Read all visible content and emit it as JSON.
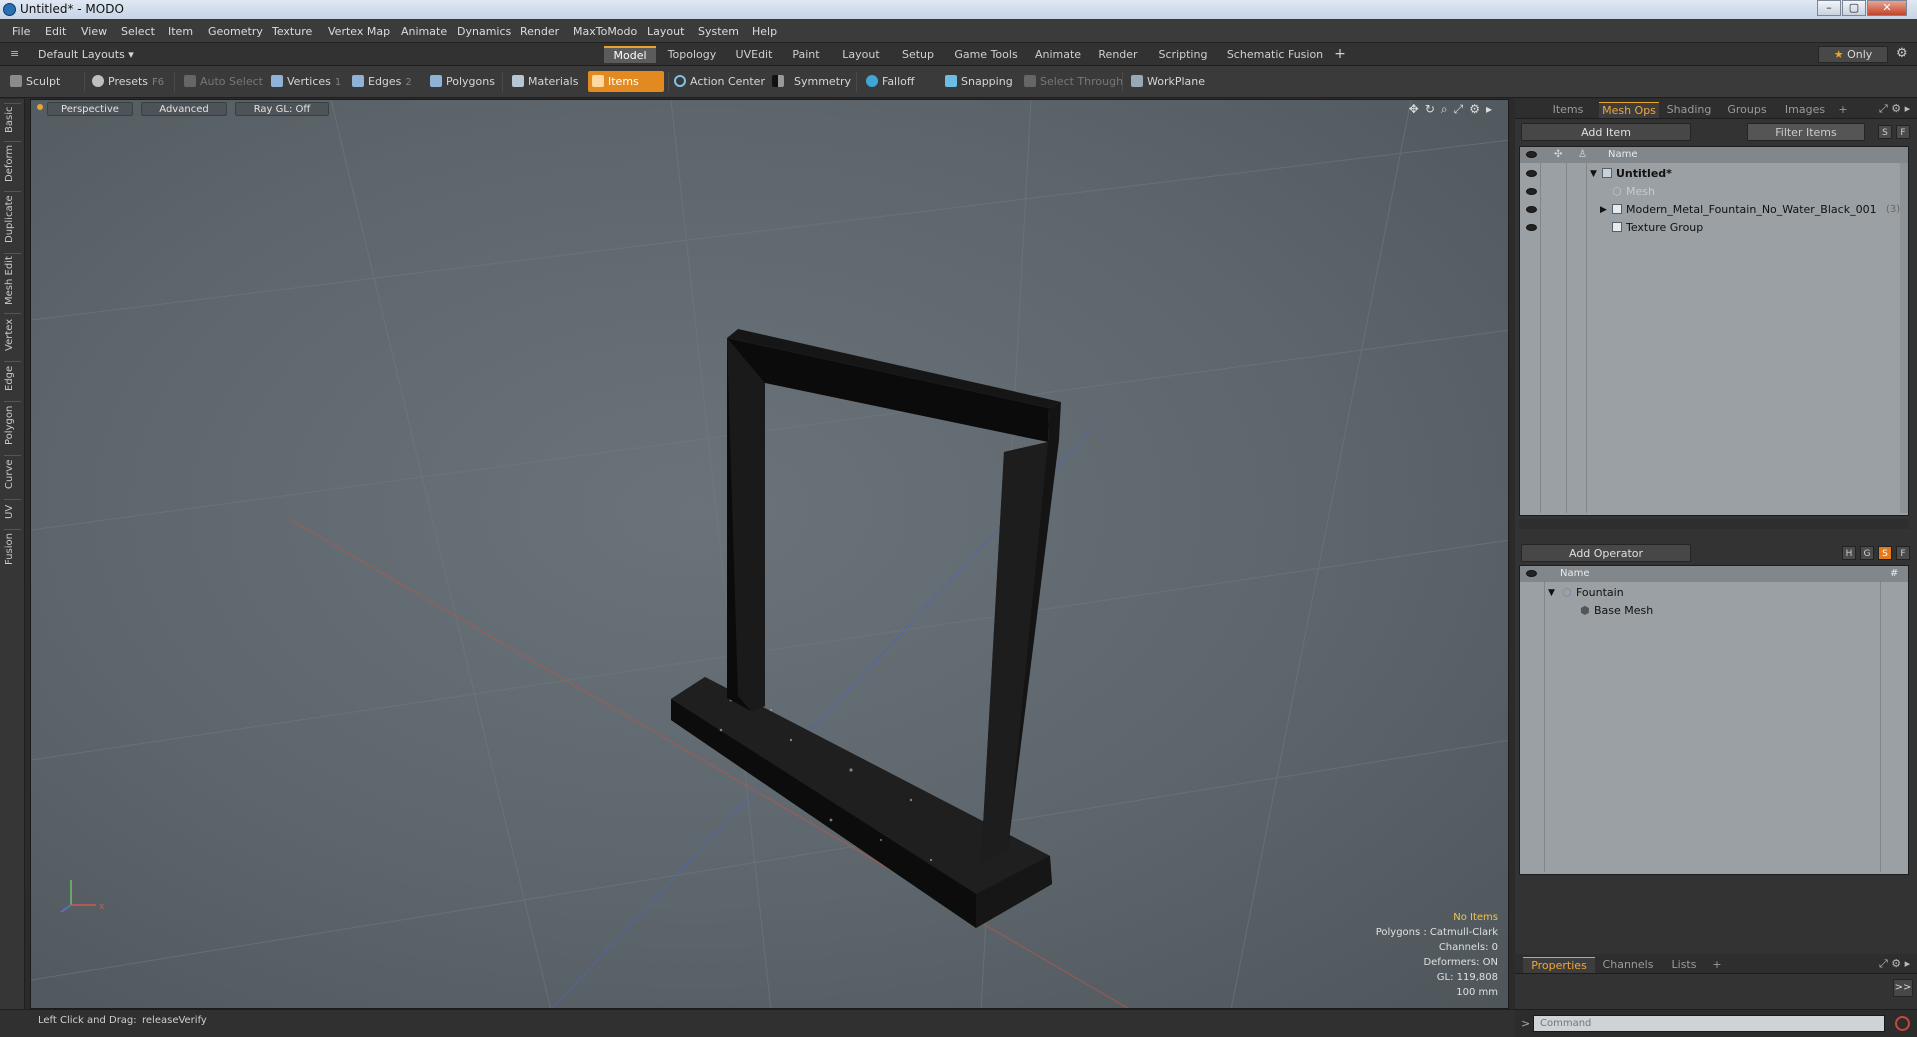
{
  "window": {
    "title": "Untitled* - MODO",
    "controls": [
      "–",
      "▢",
      "✕"
    ]
  },
  "menu": [
    "File",
    "Edit",
    "View",
    "Select",
    "Item",
    "Geometry",
    "Texture",
    "Vertex Map",
    "Animate",
    "Dynamics",
    "Render",
    "MaxToModo",
    "Layout",
    "System",
    "Help"
  ],
  "layout_bar": {
    "layout_name": "Default Layouts ▾",
    "tabs": [
      "Model",
      "Topology",
      "UVEdit",
      "Paint",
      "Layout",
      "Setup",
      "Game Tools",
      "Animate",
      "Render",
      "Scripting",
      "Schematic Fusion"
    ],
    "active_tab": "Model",
    "add_tab": "+",
    "only_label": "Only"
  },
  "toolbar": {
    "sculpt": "Sculpt",
    "presets": "Presets",
    "presets_key": "F6",
    "auto_select": "Auto Select",
    "vertices": "Vertices",
    "vertices_key": "1",
    "edges": "Edges",
    "edges_key": "2",
    "polygons": "Polygons",
    "materials": "Materials",
    "items": "Items",
    "action_center": "Action Center",
    "symmetry": "Symmetry",
    "falloff": "Falloff",
    "snapping": "Snapping",
    "select_through": "Select Through",
    "workplane": "WorkPlane"
  },
  "left_tabs": [
    "Basic",
    "Deform",
    "Duplicate",
    "Mesh Edit",
    "Vertex",
    "Edge",
    "Polygon",
    "Curve",
    "UV",
    "Fusion"
  ],
  "viewport": {
    "view_mode": "Perspective",
    "shading": "Advanced",
    "raygl": "Ray GL: Off",
    "stats": {
      "selection": "No Items",
      "polygons": "Polygons : Catmull-Clark",
      "channels": "Channels: 0",
      "deformers": "Deformers: ON",
      "gl": "GL: 119,808",
      "grid": "100 mm"
    }
  },
  "status_bar": {
    "hint": "Left Click and Drag:",
    "action": "releaseVerify"
  },
  "item_panel": {
    "tabs": [
      "Items",
      "Mesh Ops",
      "Shading",
      "Groups",
      "Images",
      "+"
    ],
    "active_tab": "Mesh Ops",
    "add_item": "Add Item",
    "filter": "Filter Items",
    "btn_s": "S",
    "btn_f": "F",
    "col_name": "Name",
    "tree": [
      {
        "label": "Untitled*",
        "bold": true
      },
      {
        "label": "Mesh",
        "dim": true
      },
      {
        "label": "Modern_Metal_Fountain_No_Water_Black_001",
        "count": "(3)"
      },
      {
        "label": "Texture Group"
      }
    ]
  },
  "meshops_panel": {
    "add_operator": "Add Operator",
    "btns": [
      "H",
      "G",
      "S",
      "F"
    ],
    "col_name": "Name",
    "col_hash": "#",
    "tree": [
      {
        "label": "Fountain"
      },
      {
        "label": "Base Mesh"
      }
    ]
  },
  "properties_panel": {
    "tabs": [
      "Properties",
      "Channels",
      "Lists",
      "+"
    ],
    "active_tab": "Properties",
    "expand": ">>"
  },
  "command_bar": {
    "placeholder": "Command",
    "arrow": ">"
  },
  "colors": {
    "accent": "#e8a430",
    "viewport_bg": "#5f686e",
    "panel_bg": "#9aa0a4"
  }
}
